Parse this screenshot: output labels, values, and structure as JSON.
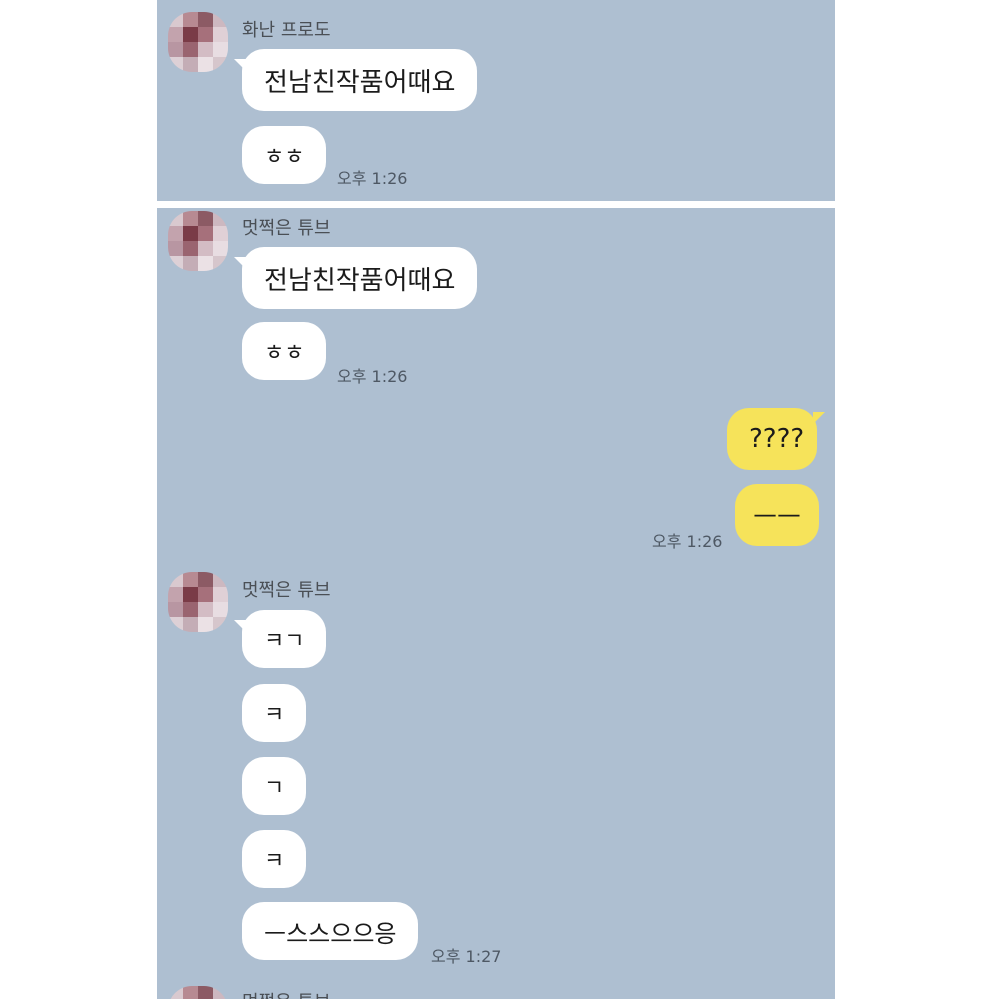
{
  "screens": [
    {
      "sender": "화난 프로도",
      "messages": [
        "전남친작품어때요",
        "ㅎㅎ"
      ],
      "time": "오후 1:26"
    },
    {
      "sender": "멋쩍은 튜브",
      "messages": [
        "전남친작품어때요",
        "ㅎㅎ"
      ],
      "time": "오후 1:26",
      "my_messages": [
        "????",
        "ㅡㅡ"
      ],
      "my_time": "오후 1:26",
      "reply_sender": "멋쩍은 튜브",
      "replies": [
        "ㅋㄱ",
        "ㅋ",
        "ㄱ",
        "ㅋ",
        "ㅡ스스으으응"
      ],
      "reply_time": "오후 1:27",
      "next_sender": "멋쩍은 튜브"
    }
  ],
  "colors": {
    "chat_background": "#aebfd1",
    "incoming_bubble": "#ffffff",
    "outgoing_bubble": "#f6e35a",
    "divider": "#ffffff"
  },
  "icons": {
    "avatar": "pixelated-profile-avatar-icon"
  }
}
